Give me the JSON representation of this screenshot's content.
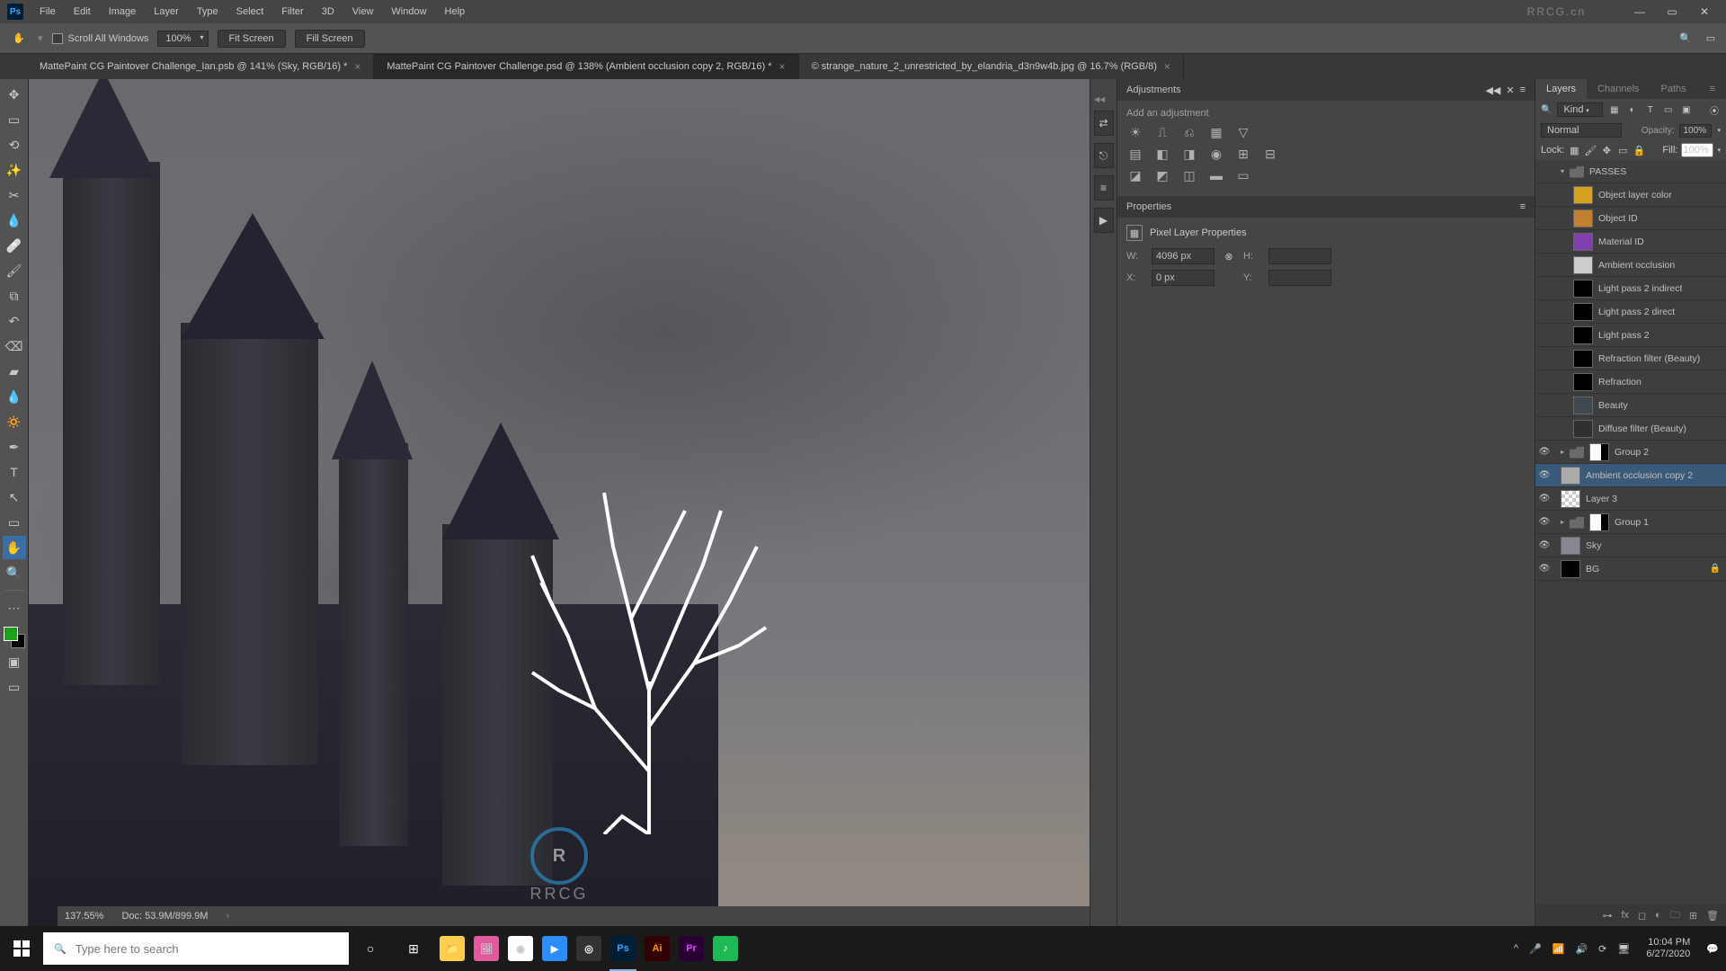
{
  "menubar": {
    "items": [
      "File",
      "Edit",
      "Image",
      "Layer",
      "Type",
      "Select",
      "Filter",
      "3D",
      "View",
      "Window",
      "Help"
    ],
    "watermark": "RRCG.cn"
  },
  "optionsbar": {
    "scroll_all": "Scroll All Windows",
    "zoom": "100%",
    "fit_screen": "Fit Screen",
    "fill_screen": "Fill Screen"
  },
  "tabs": [
    {
      "label": "MattePaint CG Paintover Challenge_Ian.psb @ 141% (Sky, RGB/16) *",
      "active": false
    },
    {
      "label": "MattePaint CG Paintover Challenge.psd @ 138% (Ambient occlusion copy 2, RGB/16) *",
      "active": true
    },
    {
      "label": "© strange_nature_2_unrestricted_by_elandria_d3n9w4b.jpg @ 16.7% (RGB/8)",
      "active": false
    }
  ],
  "adjustments": {
    "title": "Adjustments",
    "subtitle": "Add an adjustment"
  },
  "properties": {
    "title": "Properties",
    "subtitle": "Pixel Layer Properties",
    "w_label": "W:",
    "w_value": "4096 px",
    "h_label": "H:",
    "h_value": "",
    "x_label": "X:",
    "x_value": "0 px",
    "y_label": "Y:",
    "y_value": ""
  },
  "layers_panel": {
    "tabs": [
      "Layers",
      "Channels",
      "Paths"
    ],
    "filter_label": "Kind",
    "blend_mode": "Normal",
    "opacity_label": "Opacity:",
    "opacity_value": "100%",
    "lock_label": "Lock:",
    "fill_label": "Fill:",
    "fill_value": "100%",
    "layers": [
      {
        "type": "group",
        "name": "PASSES",
        "vis": false,
        "indent": 0,
        "open": true
      },
      {
        "type": "layer",
        "name": "Object layer color",
        "vis": false,
        "indent": 1,
        "thumb": "#d4a020"
      },
      {
        "type": "layer",
        "name": "Object ID",
        "vis": false,
        "indent": 1,
        "thumb": "#c08030"
      },
      {
        "type": "layer",
        "name": "Material ID",
        "vis": false,
        "indent": 1,
        "thumb": "#8040b0"
      },
      {
        "type": "layer",
        "name": "Ambient occlusion",
        "vis": false,
        "indent": 1,
        "thumb": "#cccccc"
      },
      {
        "type": "layer",
        "name": "Light pass 2 indirect",
        "vis": false,
        "indent": 1,
        "thumb": "#000000"
      },
      {
        "type": "layer",
        "name": "Light pass 2 direct",
        "vis": false,
        "indent": 1,
        "thumb": "#000000"
      },
      {
        "type": "layer",
        "name": "Light pass 2",
        "vis": false,
        "indent": 1,
        "thumb": "#000000"
      },
      {
        "type": "layer",
        "name": "Refraction filter (Beauty)",
        "vis": false,
        "indent": 1,
        "thumb": "#000000"
      },
      {
        "type": "layer",
        "name": "Refraction",
        "vis": false,
        "indent": 1,
        "thumb": "#000000"
      },
      {
        "type": "layer",
        "name": "Beauty",
        "vis": false,
        "indent": 1,
        "thumb": "#404850"
      },
      {
        "type": "layer",
        "name": "Diffuse filter (Beauty)",
        "vis": false,
        "indent": 1,
        "thumb": "#303030"
      },
      {
        "type": "group",
        "name": "Group 2",
        "vis": true,
        "indent": 0,
        "open": false,
        "mask": true
      },
      {
        "type": "layer",
        "name": "Ambient occlusion copy 2",
        "vis": true,
        "indent": 0,
        "thumb": "#aaaaaa",
        "selected": true
      },
      {
        "type": "layer",
        "name": "Layer 3",
        "vis": true,
        "indent": 0,
        "thumb": "checker"
      },
      {
        "type": "group",
        "name": "Group 1",
        "vis": true,
        "indent": 0,
        "open": false,
        "mask": true
      },
      {
        "type": "layer",
        "name": "Sky",
        "vis": true,
        "indent": 0,
        "thumb": "#888890"
      },
      {
        "type": "layer",
        "name": "BG",
        "vis": true,
        "indent": 0,
        "thumb": "#000000",
        "locked": true
      }
    ]
  },
  "status": {
    "zoom": "137.55%",
    "doc": "Doc: 53.9M/899.9M"
  },
  "taskbar": {
    "search_placeholder": "Type here to search",
    "time": "10:04 PM",
    "date": "6/27/2020"
  }
}
